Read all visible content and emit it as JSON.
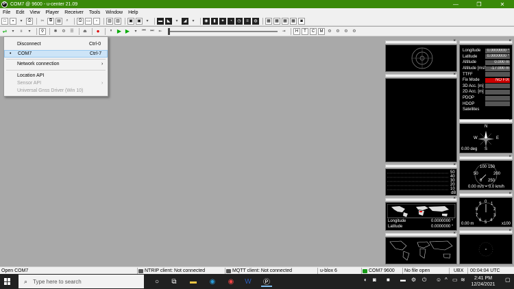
{
  "window": {
    "title": "COM7 @ 9600 - u-center 21.09",
    "app_icon": "P",
    "minimize": "—",
    "maximize": "❐",
    "close": "✕"
  },
  "menu": [
    "File",
    "Edit",
    "View",
    "Player",
    "Receiver",
    "Tools",
    "Window",
    "Help"
  ],
  "dropdown": {
    "disconnect": {
      "label": "Disconnect",
      "shortcut": "Ctrl-0"
    },
    "com7": {
      "label": "COM7",
      "shortcut": "Ctrl-7",
      "bullet": "•"
    },
    "network": {
      "label": "Network connection",
      "arrow": "›"
    },
    "location_api": {
      "label": "Location API"
    },
    "sensor_api": {
      "label": "Sensor API",
      "arrow": "›"
    },
    "gnss_driver": {
      "label": "Universal Gnss Driver (Win 10)"
    }
  },
  "nav_data": {
    "rows": [
      {
        "label": "Longitude",
        "value": "0.0000000 °"
      },
      {
        "label": "Latitude",
        "value": "0.0000000 °"
      },
      {
        "label": "Altitude",
        "value": "0.000 m"
      },
      {
        "label": "Altitude [msl]",
        "value": "-17.000 m"
      },
      {
        "label": "TTFF",
        "value": ""
      },
      {
        "label": "Fix Mode",
        "value": "NO FIX"
      },
      {
        "label": "3D Acc. [m]",
        "value": ""
      },
      {
        "label": "2D Acc. [m]",
        "value": ""
      },
      {
        "label": "PDOP",
        "value": ""
      },
      {
        "label": "HDOP",
        "value": ""
      },
      {
        "label": "Satellites",
        "value": ""
      }
    ]
  },
  "compass": {
    "n": "N",
    "w": "W",
    "e": "E",
    "s": "S",
    "deg": "0.00 deg"
  },
  "speedo": {
    "t1": "100",
    "t2": "150",
    "t3": "50",
    "t4": "200",
    "t5": "0",
    "t6": "250",
    "readout": "0.00 m/s = 0.0 km/h"
  },
  "altimeter": {
    "n0": "0",
    "n1": "1",
    "n2": "2",
    "n3": "3",
    "n4": "4",
    "n5": "5",
    "n6": "6",
    "n7": "7",
    "n8": "8",
    "n9": "9",
    "readout": "0.00 m",
    "mult": "x100"
  },
  "signal": {
    "ticks": [
      "50",
      "40",
      "30",
      "20",
      "10"
    ],
    "unit": "dB"
  },
  "world_map": {
    "lon_label": "Longitude",
    "lon_value": "0.0000000 °",
    "lat_label": "Latitude",
    "lat_value": "0.0000000 °"
  },
  "status": {
    "left": "Open COM7",
    "ntrip": "NTRIP client: Not connected",
    "mqtt": "MQTT client: Not connected",
    "device": "u-blox 6",
    "port": "COM7 9600",
    "file": "No file open",
    "protocol": "UBX",
    "time": "00:04:04 UTC"
  },
  "taskbar": {
    "search_placeholder": "Type here to search",
    "time": "2:41 PM",
    "date": "12/24/2021"
  },
  "colors": {
    "title_green": "#3a8a0a",
    "fix_red": "#cc0000"
  }
}
